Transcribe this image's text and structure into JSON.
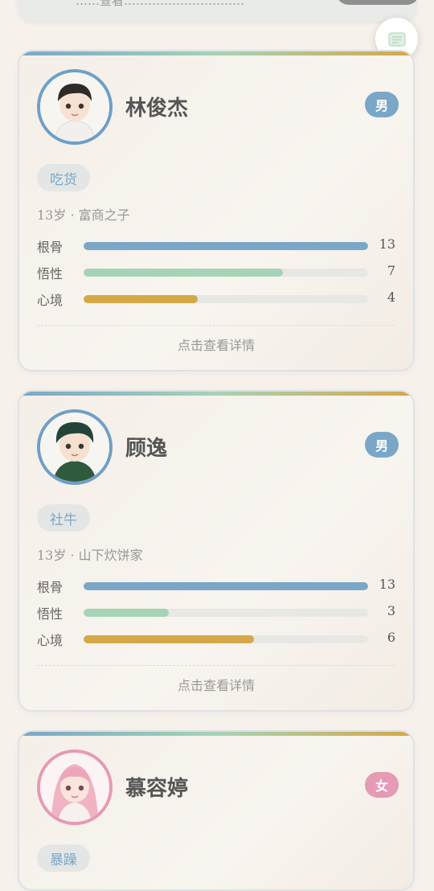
{
  "top_banner": {
    "text": "……查看…………………………"
  },
  "float_button": {
    "icon": "scroll-icon"
  },
  "characters": [
    {
      "name": "林俊杰",
      "gender": "男",
      "tag": "吃货",
      "info": "13岁 · 富商之子",
      "avatar": "boy-avatar",
      "stats": [
        {
          "label": "根骨",
          "value": "13",
          "fraction": 1.0
        },
        {
          "label": "悟性",
          "value": "7",
          "fraction": 0.7
        },
        {
          "label": "心境",
          "value": "4",
          "fraction": 0.4
        }
      ],
      "detail_label": "点击查看详情"
    },
    {
      "name": "顾逸",
      "gender": "男",
      "tag": "社牛",
      "info": "13岁 · 山下炊饼家",
      "avatar": "boy-avatar-green",
      "stats": [
        {
          "label": "根骨",
          "value": "13",
          "fraction": 1.0
        },
        {
          "label": "悟性",
          "value": "3",
          "fraction": 0.3
        },
        {
          "label": "心境",
          "value": "6",
          "fraction": 0.6
        }
      ],
      "detail_label": "点击查看详情"
    },
    {
      "name": "慕容婷",
      "gender": "女",
      "tag": "暴躁",
      "avatar": "girl-avatar"
    }
  ],
  "colors": {
    "gengu": "#7aa7c7",
    "wuxing": "#a6d3b6",
    "xinjing": "#d5a846",
    "male": "#7aa7c7",
    "female": "#e59ab5"
  }
}
